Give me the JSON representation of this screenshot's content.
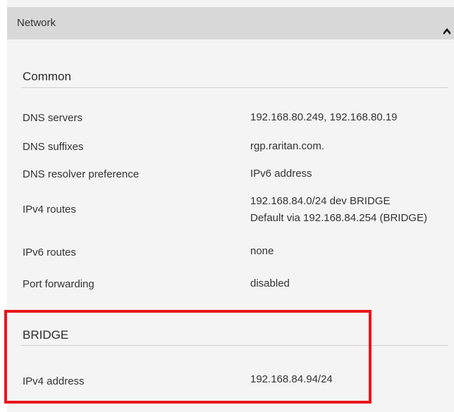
{
  "panel": {
    "title": "Network",
    "collapse_icon": "chevron-up-icon"
  },
  "common": {
    "title": "Common",
    "rows": [
      {
        "label": "DNS servers",
        "values": [
          "192.168.80.249, 192.168.80.19"
        ]
      },
      {
        "label": "DNS suffixes",
        "values": [
          "rgp.raritan.com."
        ]
      },
      {
        "label": "DNS resolver preference",
        "values": [
          "IPv6 address"
        ]
      },
      {
        "label": "IPv4 routes",
        "values": [
          "192.168.84.0/24 dev BRIDGE",
          "Default via 192.168.84.254 (BRIDGE)"
        ]
      },
      {
        "label": "IPv6 routes",
        "values": [
          "none"
        ]
      },
      {
        "label": "Port forwarding",
        "values": [
          "disabled"
        ]
      }
    ]
  },
  "bridge": {
    "title": "BRIDGE",
    "rows": [
      {
        "label": "IPv4 address",
        "values": [
          "192.168.84.94/24"
        ]
      }
    ]
  },
  "highlight": {
    "color": "#e8161c"
  }
}
